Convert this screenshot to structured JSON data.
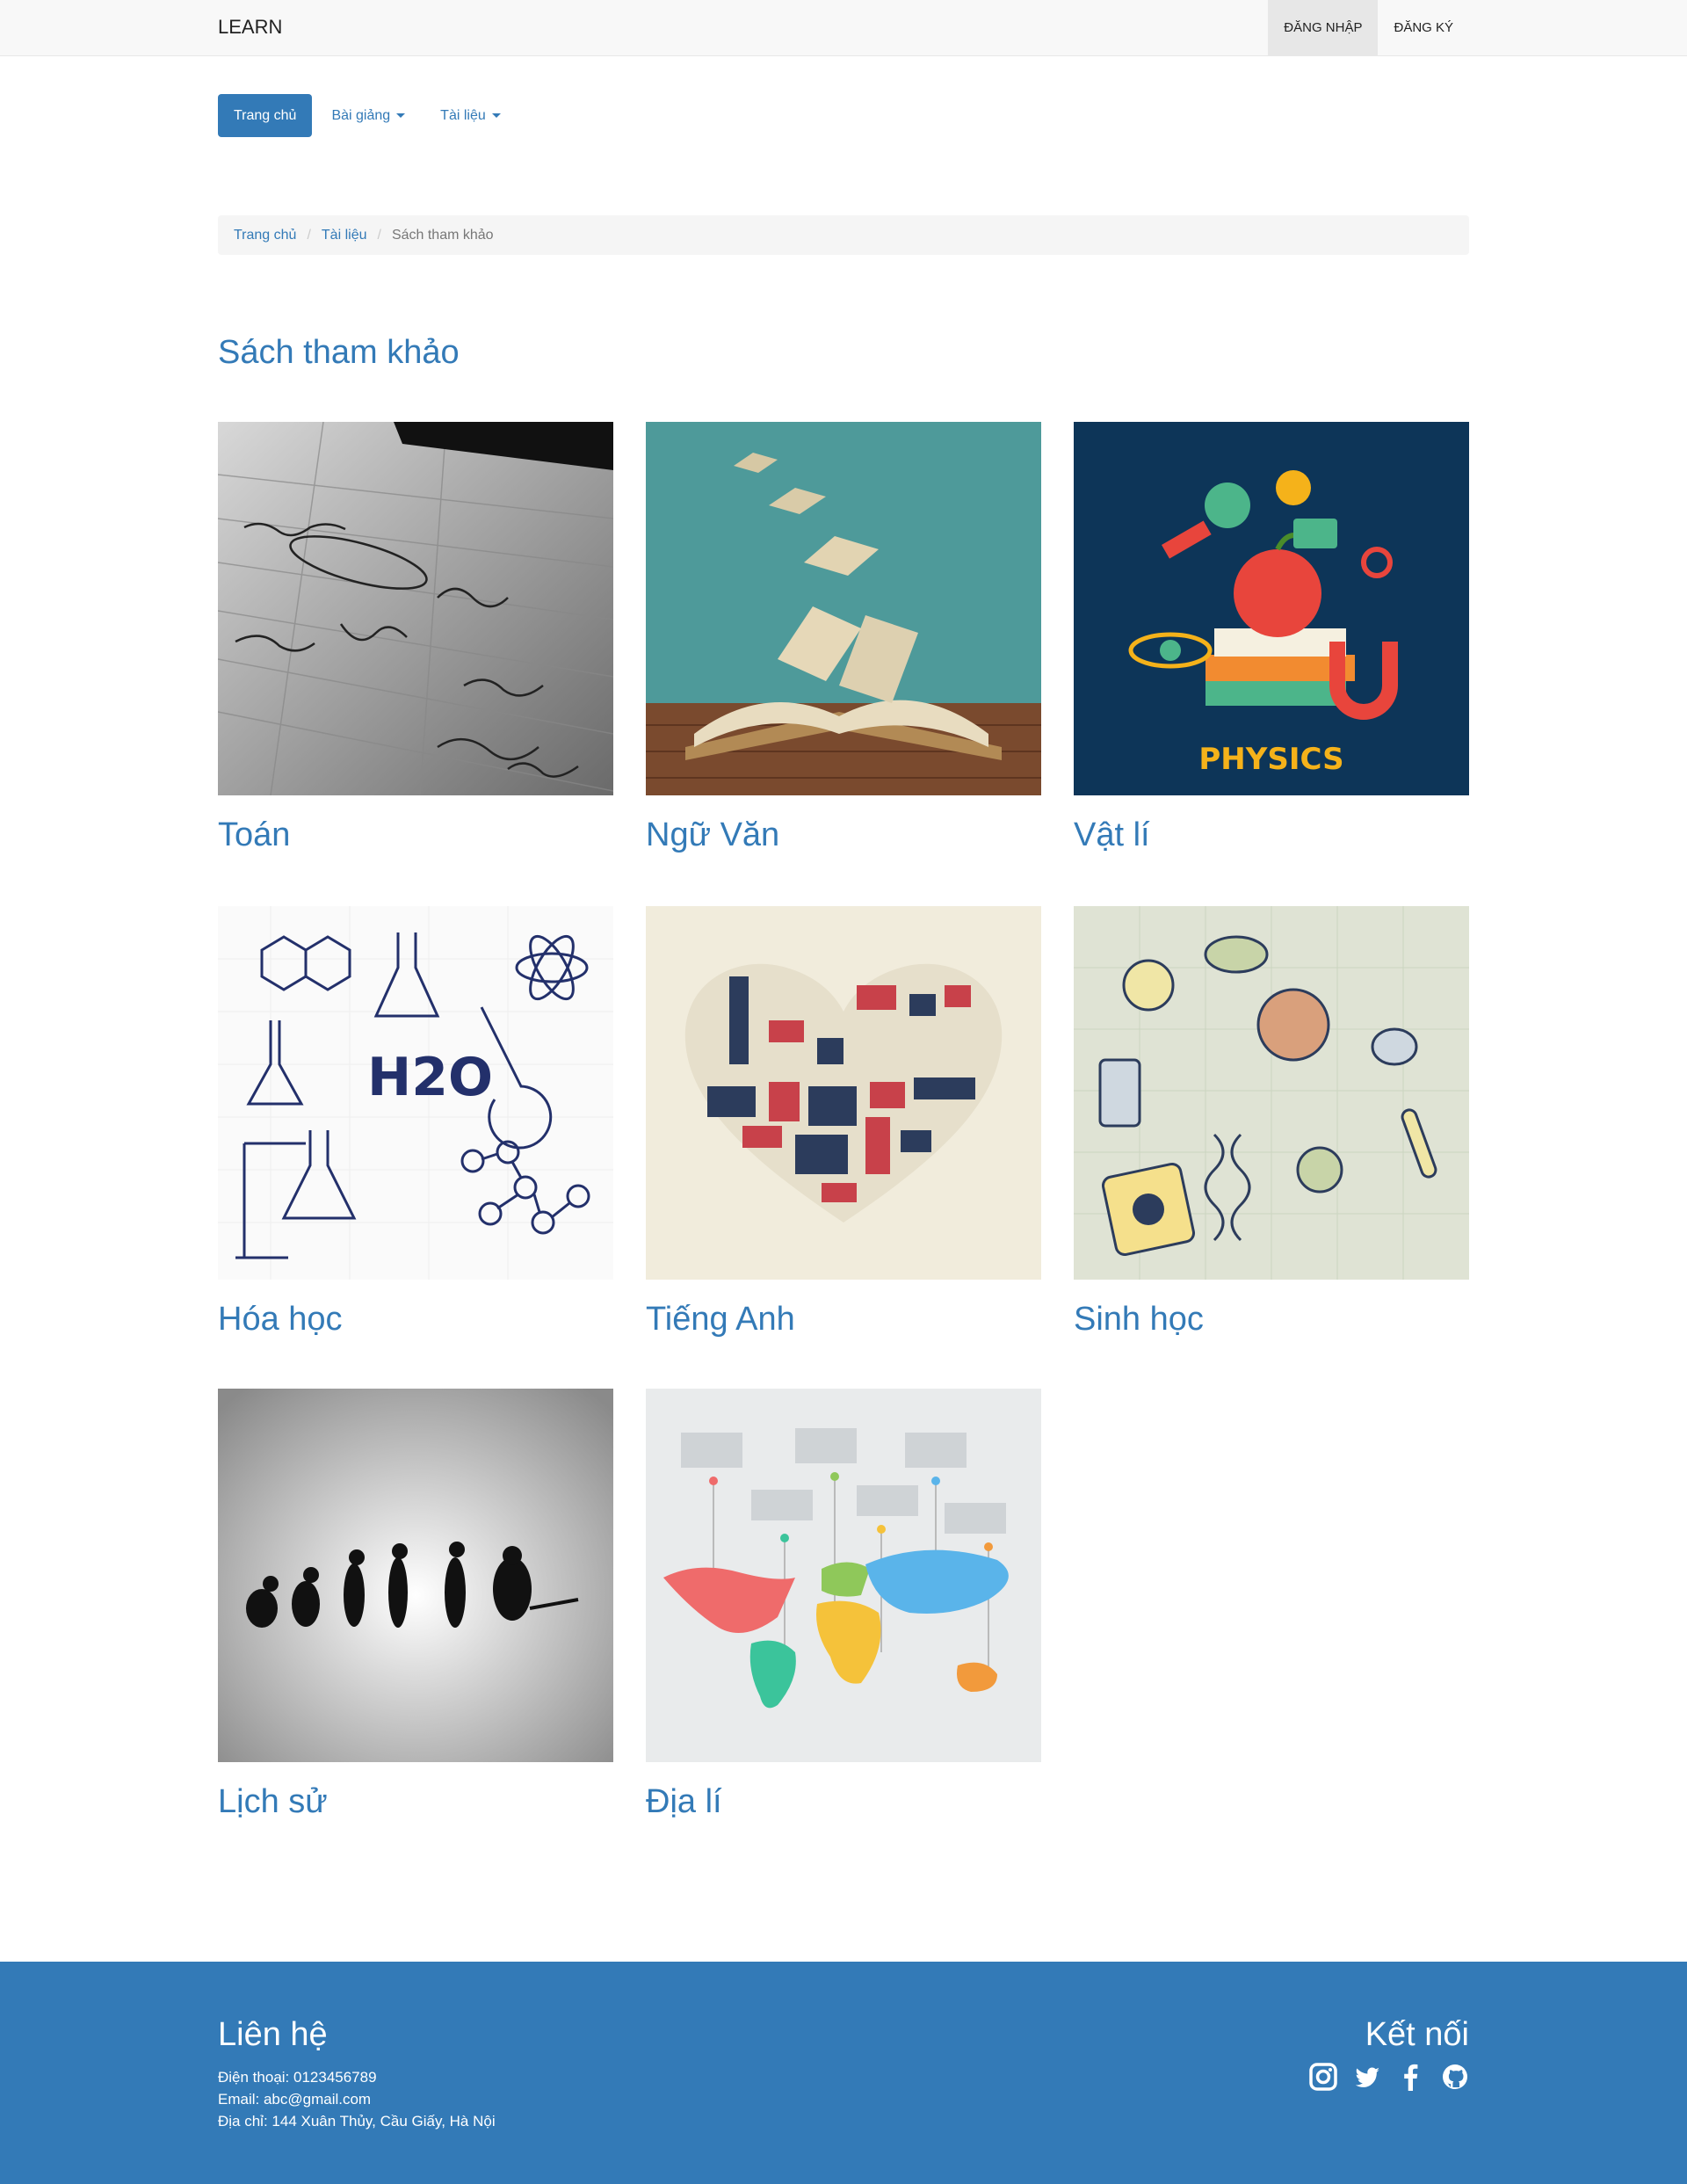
{
  "navbar": {
    "brand": "LEARN",
    "login": "ĐĂNG NHẬP",
    "register": "ĐĂNG KÝ"
  },
  "pills": {
    "home": "Trang chủ",
    "lectures": "Bài giảng",
    "documents": "Tài liệu"
  },
  "breadcrumb": {
    "home": "Trang chủ",
    "documents": "Tài liệu",
    "current": "Sách tham khảo"
  },
  "page": {
    "title": "Sách tham khảo"
  },
  "subjects": [
    {
      "title": "Toán",
      "image": "math-notebook-photo"
    },
    {
      "title": "Ngữ Văn",
      "image": "open-book-photo"
    },
    {
      "title": "Vật lí",
      "image": "physics-illustration",
      "image_text": "PHYSICS"
    },
    {
      "title": "Hóa học",
      "image": "chemistry-sketch",
      "image_text": "H2O"
    },
    {
      "title": "Tiếng Anh",
      "image": "london-heart-illustration"
    },
    {
      "title": "Sinh học",
      "image": "biology-sketch"
    },
    {
      "title": "Lịch sử",
      "image": "evolution-silhouette"
    },
    {
      "title": "Địa lí",
      "image": "world-map-infographic"
    }
  ],
  "footer": {
    "contact_title": "Liên hệ",
    "phone": "Điện thoại: 0123456789",
    "email": "Email: abc@gmail.com",
    "address": "Địa chỉ: 144 Xuân Thủy, Cầu Giấy, Hà Nội",
    "connect_title": "Kết nối",
    "icons": [
      "instagram-icon",
      "twitter-icon",
      "facebook-icon",
      "github-icon"
    ]
  },
  "colors": {
    "primary": "#337ab7",
    "navbar_bg": "#f8f8f8",
    "footer_bg": "#337ab7"
  }
}
